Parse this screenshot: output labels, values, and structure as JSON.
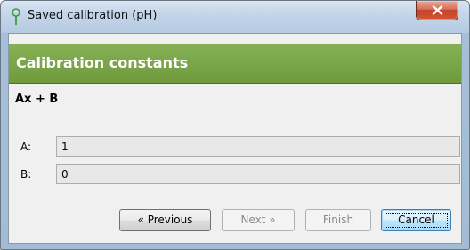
{
  "window": {
    "title": "Saved calibration (pH)",
    "close_label": "X"
  },
  "header": {
    "title": "Calibration constants",
    "color": "#76a045"
  },
  "formula": "Ax + B",
  "fields": [
    {
      "label": "A:",
      "value": "1"
    },
    {
      "label": "B:",
      "value": "0"
    }
  ],
  "buttons": {
    "previous": "« Previous",
    "next": "Next »",
    "finish": "Finish",
    "cancel": "Cancel"
  },
  "icons": {
    "app": "ph-probe-icon",
    "close": "close-icon"
  }
}
